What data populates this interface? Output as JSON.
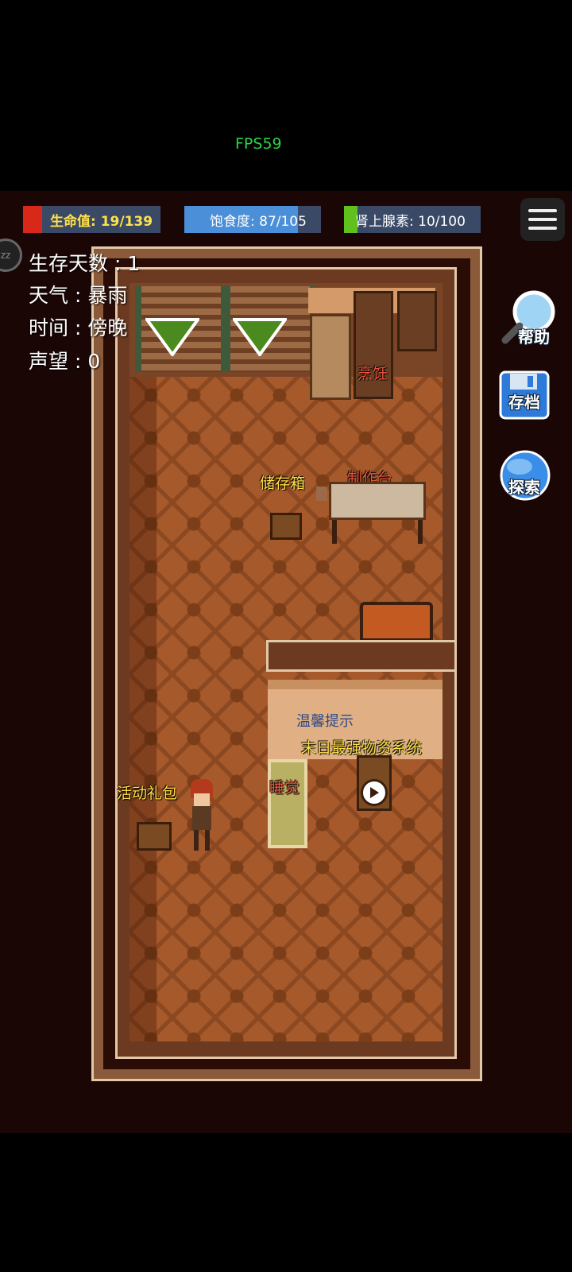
{
  "fps": "FPS59",
  "status_bars": {
    "hp": {
      "label": "生命值: 19/139",
      "fraction": 0.137,
      "color": "#d8281a"
    },
    "satiety": {
      "label": "饱食度: 87/105",
      "fraction": 0.829,
      "color": "#4a8fd8"
    },
    "adrenaline": {
      "label": "肾上腺素: 10/100",
      "fraction": 0.1,
      "color": "#5fc01e"
    }
  },
  "stats": {
    "days": "生存天数 : 1",
    "weather": "天气 : 暴雨",
    "time": "时间 : 傍晚",
    "reputation": "声望 : 0"
  },
  "sleep_badge": "zz",
  "side_buttons": {
    "help": "帮助",
    "save": "存档",
    "explore": "探索"
  },
  "room_labels": {
    "cooking": "烹饪",
    "storage": "储存箱",
    "workbench": "制作台",
    "tip": "温馨提示",
    "supply_system": "末日最强物资系统",
    "sleep": "睡觉",
    "gift": "活动礼包"
  },
  "colors": {
    "accent_yellow": "#ffe24a",
    "label_red": "#e7573e",
    "fps_green": "#2fd24a"
  }
}
